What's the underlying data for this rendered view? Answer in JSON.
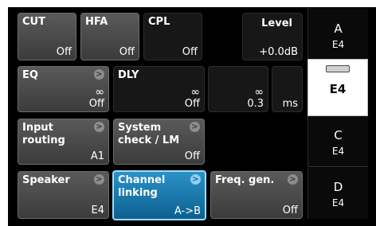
{
  "buttons": {
    "cut": {
      "label": "CUT",
      "value": "Off"
    },
    "hfa": {
      "label": "HFA",
      "value": "Off"
    },
    "cpl": {
      "label": "CPL",
      "value": "Off"
    },
    "level": {
      "label": "Level",
      "value": "+0.0dB"
    },
    "eq": {
      "label": "EQ",
      "value": "Off",
      "symbol": "∞"
    },
    "dly": {
      "label": "DLY",
      "value": "Off",
      "symbol": "∞"
    },
    "dly_time": {
      "symbol": "∞",
      "value": "0.3",
      "unit": "ms"
    },
    "input_routing": {
      "label": "Input\nrouting",
      "value": "A1"
    },
    "system_check": {
      "label": "System\ncheck / LM",
      "value": "Off"
    },
    "speaker": {
      "label": "Speaker",
      "value": "E4"
    },
    "channel_linking": {
      "label": "Channel\nlinking",
      "value": "A->B"
    },
    "freq_gen": {
      "label": "Freq. gen.",
      "value": "Off"
    }
  },
  "channels": [
    {
      "name": "A",
      "speaker": "E4"
    },
    {
      "name": "",
      "speaker": "E4"
    },
    {
      "name": "C",
      "speaker": "E4"
    },
    {
      "name": "D",
      "speaker": "E4"
    }
  ]
}
